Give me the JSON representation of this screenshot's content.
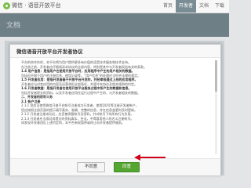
{
  "header": {
    "brand": "微信 · 语音开放平台",
    "nav": [
      "首页",
      "开发者",
      "文档",
      "下载"
    ]
  },
  "page": {
    "section_title": "文档"
  },
  "modal": {
    "title": "微信语音开放平台开发者协议",
    "paragraphs": [
      {
        "text": "平台的合作伙伴，本平台将为用户提供更多有价值的语音技术服务和技术支持。",
        "head": false
      },
      {
        "text": "在注册之前，开发者应仔细阅读本协议的全部内容，特别是其中与开发者权益有关的条款。",
        "head": false
      },
      {
        "text": "1.4 用户信息：是指用户在使用开放平台时，应用程序中产生的用户相关的数据。",
        "head": true
      },
      {
        "text": "包括但不限于用户的注册信息、使用记录等。“用户信息”的处理应当符合法律的规定。",
        "head": false
      },
      {
        "text": "1.5 开发者应用：是指开发者基于开放平台开发的，并经审核通过上线的应用程序。",
        "head": true
      },
      {
        "text": "开发者应当对其应用的内容及运营承担全部责任，并遵守本协议及相关规则的约定。",
        "head": false
      },
      {
        "text": "1.6 开发者数据：是指开发者在使用开放平台服务过程中所产生的数据和信息。",
        "head": true
      },
      {
        "text": "包括开发者提交的资料，以及开发者应用在运行过程中产生的、与开发者相关的数据。",
        "head": false
      },
      {
        "text": "二、开发者的权利义务",
        "head": true
      },
      {
        "text": "2.1 帐户注册",
        "head": true
      },
      {
        "text": "2.1.1 您应当使用微信开放平台帐号注册成为开发者，使用QQ号等注册开发者帐户。",
        "head": false
      },
      {
        "text": "您应按照注册页面的提示填写真实、准确、完整的信息，并在信息变更时及时更新。",
        "head": false
      },
      {
        "text": "2.1.2 开发者注册成功后，应妥善保管帐号及密码，并对帐号下的所有行为负责。",
        "head": false
      },
      {
        "text": "2.1.3 开发者应当保证其提交的资料真实、合法，不得冒用他人的名义注册帐号。",
        "head": false
      },
      {
        "text": "如发现开发者违反上述约定的，本平台有权暂停或终止向开发者提供服务。",
        "head": false
      }
    ],
    "decline_label": "不同意",
    "agree_label": "同意"
  }
}
